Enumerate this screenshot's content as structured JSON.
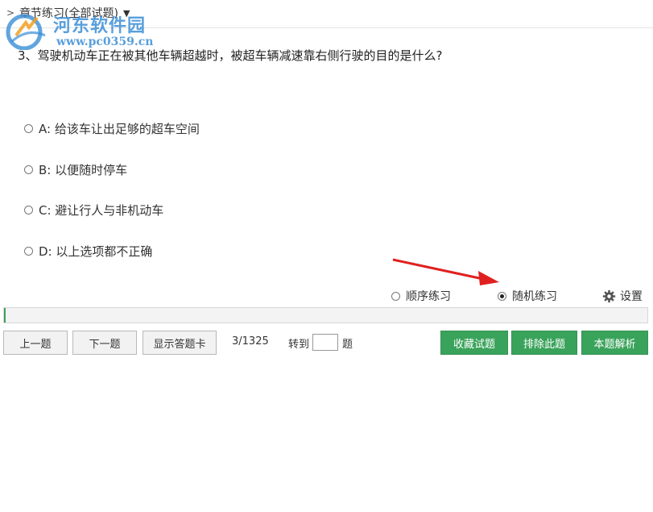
{
  "breadcrumb": {
    "label": "章节练习(全部试题)",
    "chevron_icon": "chevron-right-icon",
    "caret_icon": "caret-down-icon"
  },
  "watermark": {
    "name": "河东软件园",
    "url": "www.pc0359.cn",
    "color": "#3b8fd6"
  },
  "question": {
    "text": "3、驾驶机动车正在被其他车辆超越时，被超车辆减速靠右侧行驶的目的是什么?",
    "options": [
      {
        "label": "A: 给该车让出足够的超车空间",
        "selected": false
      },
      {
        "label": "B: 以便随时停车",
        "selected": false
      },
      {
        "label": "C: 避让行人与非机动车",
        "selected": false
      },
      {
        "label": "D: 以上选项都不正确",
        "selected": false
      }
    ]
  },
  "practice_mode": {
    "sequential_label": "顺序练习",
    "random_label": "随机练习",
    "selected": "random",
    "settings_label": "设置",
    "settings_icon": "gear-icon"
  },
  "annotation": {
    "arrow_color": "#e02020"
  },
  "progress": {
    "fraction": 0.003,
    "color": "#3aa35b"
  },
  "toolbar": {
    "prev_label": "上一题",
    "next_label": "下一题",
    "answer_card_label": "显示答题卡",
    "counter": "3/1325",
    "jump_label": "转到",
    "jump_value": "",
    "jump_suffix": "题",
    "favorite_label": "收藏试题",
    "exclude_label": "排除此题",
    "explain_label": "本题解析"
  },
  "colors": {
    "accent_green": "#3aa35b",
    "text": "#333333"
  }
}
